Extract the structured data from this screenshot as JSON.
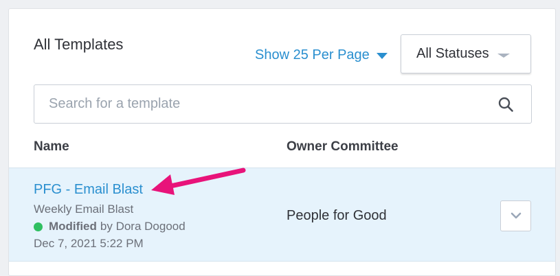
{
  "header": {
    "title": "All Templates",
    "per_page_label": "Show 25 Per Page",
    "status_filter": "All Statuses"
  },
  "search": {
    "placeholder": "Search for a template",
    "value": ""
  },
  "table": {
    "columns": [
      "Name",
      "Owner Committee"
    ],
    "rows": [
      {
        "name": "PFG - Email Blast",
        "description": "Weekly Email Blast",
        "status": "Modified",
        "modified_by": "by Dora Dogood",
        "date": "Dec 7, 2021 5:22 PM",
        "owner": "People for Good"
      }
    ]
  },
  "colors": {
    "link": "#2a8fcf",
    "status_dot": "#2fbf61",
    "row_highlight": "#e6f3fc",
    "annotation_arrow": "#e8137a"
  },
  "icons": {
    "search": "search-icon",
    "row_menu": "chevron-down-icon",
    "annotation": "arrow-icon"
  }
}
